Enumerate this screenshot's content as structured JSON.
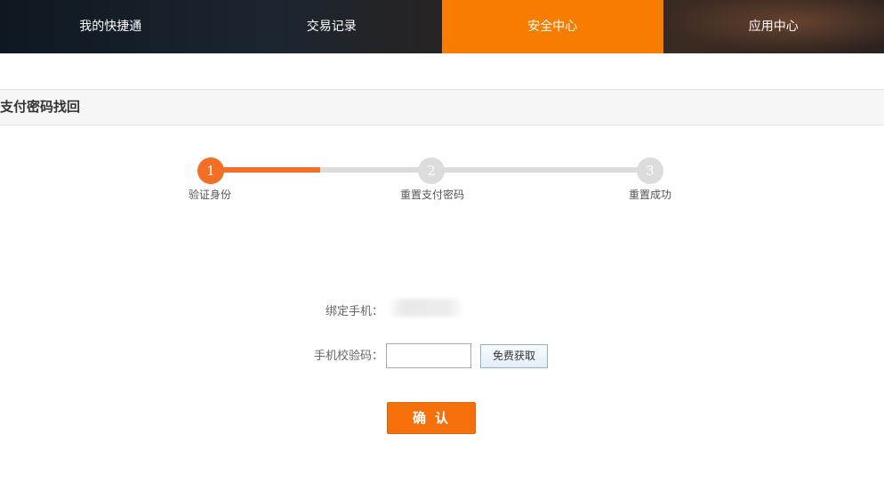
{
  "nav": {
    "items": [
      {
        "label": "我的快捷通",
        "active": false
      },
      {
        "label": "交易记录",
        "active": false
      },
      {
        "label": "安全中心",
        "active": true
      },
      {
        "label": "应用中心",
        "active": false
      }
    ]
  },
  "section": {
    "title": "支付密码找回"
  },
  "steps": [
    {
      "number": "1",
      "label": "验证身份",
      "state": "done"
    },
    {
      "number": "2",
      "label": "重置支付密码",
      "state": "todo"
    },
    {
      "number": "3",
      "label": "重置成功",
      "state": "todo"
    }
  ],
  "progress": {
    "fraction": 0.25
  },
  "form": {
    "phone_label": "绑定手机：",
    "code_label": "手机校验码：",
    "code_value": "",
    "get_code_label": "免费获取",
    "confirm_label": "确认"
  },
  "colors": {
    "accent": "#f77d00",
    "progress": "#f46f25",
    "inactive": "#dcdcdc"
  }
}
